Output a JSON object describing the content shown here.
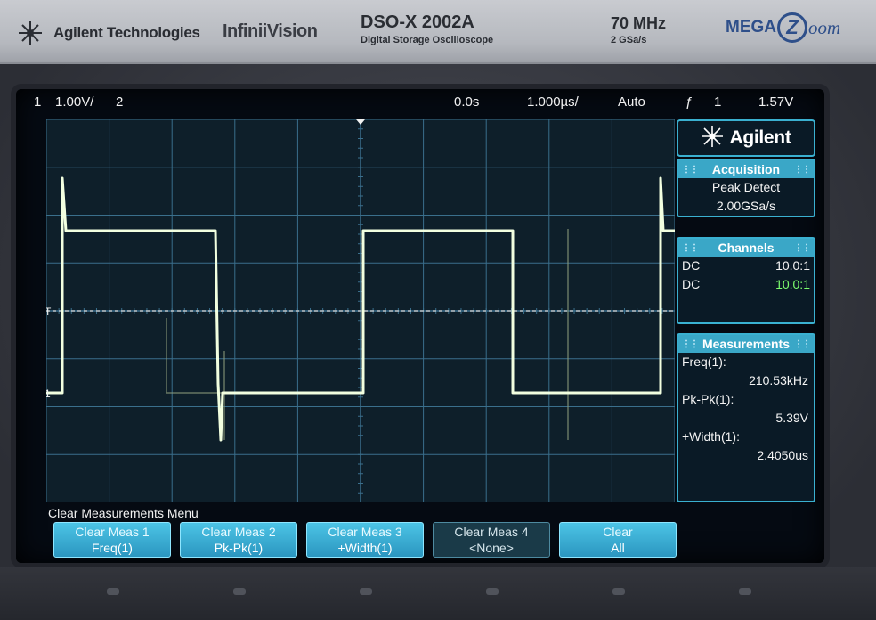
{
  "header": {
    "brand": "Agilent Technologies",
    "series": "InfiniiVision",
    "model": "DSO-X 2002A",
    "model_sub": "Digital Storage Oscilloscope",
    "bandwidth": "70 MHz",
    "sample_rate": "2 GSa/s",
    "megazoom_left": "MEGA",
    "megazoom_circle": "Z",
    "megazoom_right": "oom"
  },
  "status": {
    "ch1_num": "1",
    "ch1_scale": "1.00V/",
    "ch2_num": "2",
    "time_delay": "0.0s",
    "time_scale": "1.000µs/",
    "trigger_mode": "Auto",
    "trigger_symbol": "ƒ",
    "trigger_source": "1",
    "trigger_level": "1.57V"
  },
  "waveform": {
    "trigger_marker": "T",
    "ground_marker": "1",
    "colors": {
      "trace": "#f2ffe0",
      "ghost": "#8c9a7a",
      "grid": "#3a6f8c"
    }
  },
  "panel": {
    "logo": "Agilent",
    "acquisition": {
      "title": "Acquisition",
      "mode": "Peak Detect",
      "rate": "2.00GSa/s"
    },
    "channels": {
      "title": "Channels",
      "rows": [
        {
          "coupling": "DC",
          "probe": "10.0:1"
        },
        {
          "coupling": "DC",
          "probe": "10.0:1"
        }
      ]
    },
    "measurements": {
      "title": "Measurements",
      "items": [
        {
          "label": "Freq(1):",
          "value": "210.53kHz"
        },
        {
          "label": "Pk-Pk(1):",
          "value": "5.39V"
        },
        {
          "label": "+Width(1):",
          "value": "2.4050us"
        }
      ]
    }
  },
  "menu": {
    "title": "Clear Measurements Menu",
    "softkeys": [
      {
        "line1": "Clear Meas 1",
        "line2": "Freq(1)",
        "active": true
      },
      {
        "line1": "Clear Meas 2",
        "line2": "Pk-Pk(1)",
        "active": true
      },
      {
        "line1": "Clear Meas 3",
        "line2": "+Width(1)",
        "active": true
      },
      {
        "line1": "Clear Meas 4",
        "line2": "<None>",
        "active": false
      },
      {
        "line1": "Clear",
        "line2": "All",
        "active": true
      }
    ]
  }
}
